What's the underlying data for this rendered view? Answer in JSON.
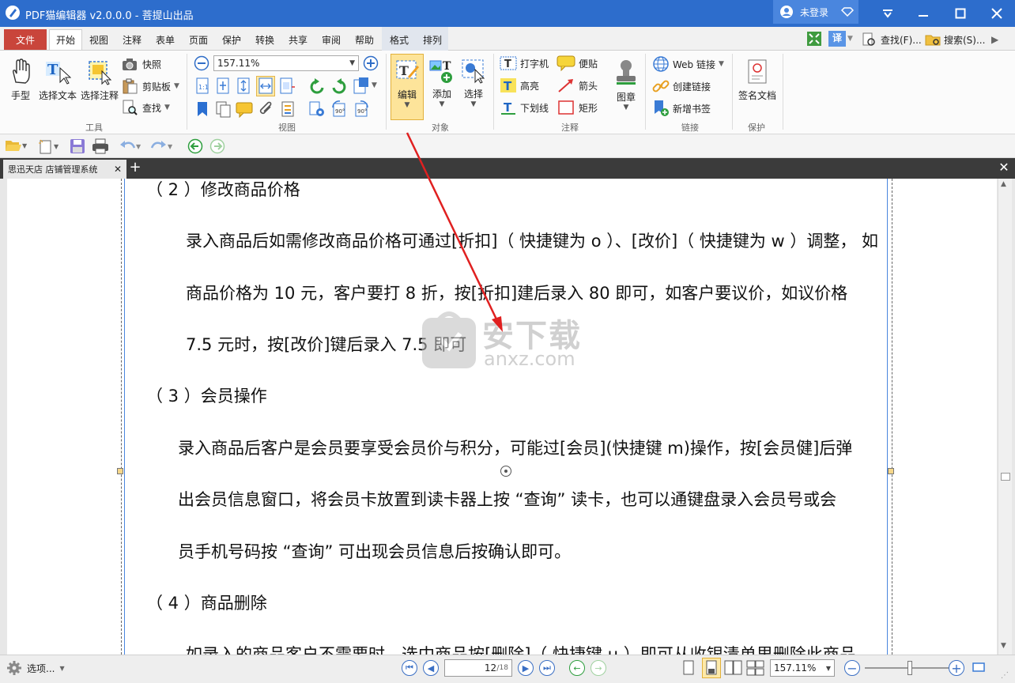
{
  "app": {
    "title": "PDF猫编辑器 v2.0.0.0 - 菩提山出品",
    "user": "未登录"
  },
  "menu": {
    "file": "文件",
    "tabs": [
      "开始",
      "视图",
      "注释",
      "表单",
      "页面",
      "保护",
      "转换",
      "共享",
      "审阅",
      "帮助",
      "格式",
      "排列"
    ],
    "active": "开始",
    "translate": "译",
    "find": "查找(F)...",
    "search": "搜索(S)..."
  },
  "ribbon": {
    "tools": {
      "hand": "手型",
      "select_text": "选择文本",
      "select_annot": "选择注释",
      "snapshot": "快照",
      "clipboard": "剪贴板",
      "find": "查找",
      "group": "工具"
    },
    "view": {
      "zoom": "157.11%",
      "group": "视图"
    },
    "object": {
      "edit": "编辑",
      "add": "添加",
      "select": "选择",
      "group": "对象"
    },
    "annot": {
      "typewriter": "打字机",
      "note": "便贴",
      "highlight": "高亮",
      "arrow": "箭头",
      "underline": "下划线",
      "rect": "矩形",
      "stamp": "图章",
      "group": "注释"
    },
    "links": {
      "web": "Web 链接",
      "create": "创建链接",
      "bookmark": "新增书签",
      "group": "链接"
    },
    "protect": {
      "sign": "签名文档",
      "group": "保护"
    }
  },
  "doc_tab": "思迅天店 店铺管理系统",
  "page": {
    "lines": [
      "（ 2 ）修改商品价格",
      "录入商品后如需修改商品价格可通过[折扣]（ 快捷键为 o ）、[改价]（ 快捷键为 w ）调整， 如",
      "商品价格为 10 元，客户要打 8 折，按[折扣]建后录入 80 即可，如客户要议价，如议价格",
      "7.5 元时，按[改价]键后录入 7.5 即可",
      "（ 3 ）会员操作",
      "录入商品后客户是会员要享受会员价与积分，可能过[会员](快捷键 m)操作，按[会员健]后弹",
      "出会员信息窗口，将会员卡放置到读卡器上按 “查询” 读卡，也可以通键盘录入会员号或会",
      "员手机号码按 “查询” 可出现会员信息后按确认即可。",
      "（ 4 ）商品删除",
      "如录入的商品客户不需要时，选中商品按[删除]（ 快捷键 u ）即可从收银清单里删除此商品"
    ],
    "watermark": "安下载",
    "watermark_url": "anxz.com"
  },
  "status": {
    "options": "选项...",
    "page_current": "12",
    "page_total": "18",
    "zoom": "157.11%"
  }
}
